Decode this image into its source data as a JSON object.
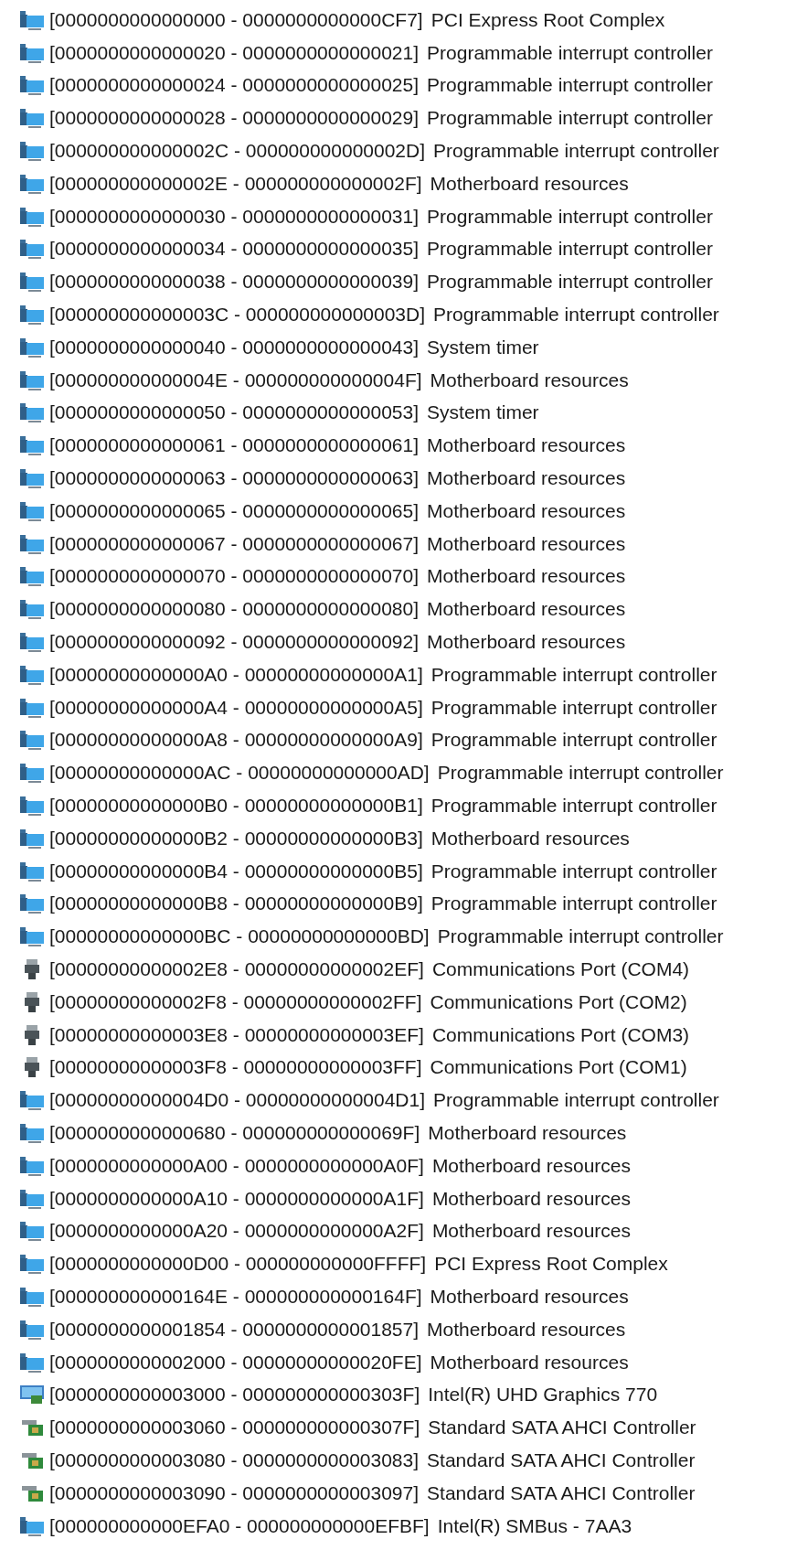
{
  "resources": [
    {
      "kind": "system",
      "range": "[0000000000000000 - 0000000000000CF7]",
      "name": "PCI Express Root Complex"
    },
    {
      "kind": "system",
      "range": "[0000000000000020 - 0000000000000021]",
      "name": "Programmable interrupt controller"
    },
    {
      "kind": "system",
      "range": "[0000000000000024 - 0000000000000025]",
      "name": "Programmable interrupt controller"
    },
    {
      "kind": "system",
      "range": "[0000000000000028 - 0000000000000029]",
      "name": "Programmable interrupt controller"
    },
    {
      "kind": "system",
      "range": "[000000000000002C - 000000000000002D]",
      "name": "Programmable interrupt controller"
    },
    {
      "kind": "system",
      "range": "[000000000000002E - 000000000000002F]",
      "name": "Motherboard resources"
    },
    {
      "kind": "system",
      "range": "[0000000000000030 - 0000000000000031]",
      "name": "Programmable interrupt controller"
    },
    {
      "kind": "system",
      "range": "[0000000000000034 - 0000000000000035]",
      "name": "Programmable interrupt controller"
    },
    {
      "kind": "system",
      "range": "[0000000000000038 - 0000000000000039]",
      "name": "Programmable interrupt controller"
    },
    {
      "kind": "system",
      "range": "[000000000000003C - 000000000000003D]",
      "name": "Programmable interrupt controller"
    },
    {
      "kind": "system",
      "range": "[0000000000000040 - 0000000000000043]",
      "name": "System timer"
    },
    {
      "kind": "system",
      "range": "[000000000000004E - 000000000000004F]",
      "name": "Motherboard resources"
    },
    {
      "kind": "system",
      "range": "[0000000000000050 - 0000000000000053]",
      "name": "System timer"
    },
    {
      "kind": "system",
      "range": "[0000000000000061 - 0000000000000061]",
      "name": "Motherboard resources"
    },
    {
      "kind": "system",
      "range": "[0000000000000063 - 0000000000000063]",
      "name": "Motherboard resources"
    },
    {
      "kind": "system",
      "range": "[0000000000000065 - 0000000000000065]",
      "name": "Motherboard resources"
    },
    {
      "kind": "system",
      "range": "[0000000000000067 - 0000000000000067]",
      "name": "Motherboard resources"
    },
    {
      "kind": "system",
      "range": "[0000000000000070 - 0000000000000070]",
      "name": "Motherboard resources"
    },
    {
      "kind": "system",
      "range": "[0000000000000080 - 0000000000000080]",
      "name": "Motherboard resources"
    },
    {
      "kind": "system",
      "range": "[0000000000000092 - 0000000000000092]",
      "name": "Motherboard resources"
    },
    {
      "kind": "system",
      "range": "[00000000000000A0 - 00000000000000A1]",
      "name": "Programmable interrupt controller"
    },
    {
      "kind": "system",
      "range": "[00000000000000A4 - 00000000000000A5]",
      "name": "Programmable interrupt controller"
    },
    {
      "kind": "system",
      "range": "[00000000000000A8 - 00000000000000A9]",
      "name": "Programmable interrupt controller"
    },
    {
      "kind": "system",
      "range": "[00000000000000AC - 00000000000000AD]",
      "name": "Programmable interrupt controller"
    },
    {
      "kind": "system",
      "range": "[00000000000000B0 - 00000000000000B1]",
      "name": "Programmable interrupt controller"
    },
    {
      "kind": "system",
      "range": "[00000000000000B2 - 00000000000000B3]",
      "name": "Motherboard resources"
    },
    {
      "kind": "system",
      "range": "[00000000000000B4 - 00000000000000B5]",
      "name": "Programmable interrupt controller"
    },
    {
      "kind": "system",
      "range": "[00000000000000B8 - 00000000000000B9]",
      "name": "Programmable interrupt controller"
    },
    {
      "kind": "system",
      "range": "[00000000000000BC - 00000000000000BD]",
      "name": "Programmable interrupt controller"
    },
    {
      "kind": "port",
      "range": "[00000000000002E8 - 00000000000002EF]",
      "name": "Communications Port (COM4)"
    },
    {
      "kind": "port",
      "range": "[00000000000002F8 - 00000000000002FF]",
      "name": "Communications Port (COM2)"
    },
    {
      "kind": "port",
      "range": "[00000000000003E8 - 00000000000003EF]",
      "name": "Communications Port (COM3)"
    },
    {
      "kind": "port",
      "range": "[00000000000003F8 - 00000000000003FF]",
      "name": "Communications Port (COM1)"
    },
    {
      "kind": "system",
      "range": "[00000000000004D0 - 00000000000004D1]",
      "name": "Programmable interrupt controller"
    },
    {
      "kind": "system",
      "range": "[0000000000000680 - 000000000000069F]",
      "name": "Motherboard resources"
    },
    {
      "kind": "system",
      "range": "[0000000000000A00 - 0000000000000A0F]",
      "name": "Motherboard resources"
    },
    {
      "kind": "system",
      "range": "[0000000000000A10 - 0000000000000A1F]",
      "name": "Motherboard resources"
    },
    {
      "kind": "system",
      "range": "[0000000000000A20 - 0000000000000A2F]",
      "name": "Motherboard resources"
    },
    {
      "kind": "system",
      "range": "[0000000000000D00 - 000000000000FFFF]",
      "name": "PCI Express Root Complex"
    },
    {
      "kind": "system",
      "range": "[000000000000164E - 000000000000164F]",
      "name": "Motherboard resources"
    },
    {
      "kind": "system",
      "range": "[0000000000001854 - 0000000000001857]",
      "name": "Motherboard resources"
    },
    {
      "kind": "system",
      "range": "[0000000000002000 - 00000000000020FE]",
      "name": "Motherboard resources"
    },
    {
      "kind": "display",
      "range": "[0000000000003000 - 000000000000303F]",
      "name": "Intel(R) UHD Graphics 770"
    },
    {
      "kind": "storage",
      "range": "[0000000000003060 - 000000000000307F]",
      "name": "Standard SATA AHCI Controller"
    },
    {
      "kind": "storage",
      "range": "[0000000000003080 - 0000000000003083]",
      "name": "Standard SATA AHCI Controller"
    },
    {
      "kind": "storage",
      "range": "[0000000000003090 - 0000000000003097]",
      "name": "Standard SATA AHCI Controller"
    },
    {
      "kind": "system",
      "range": "[000000000000EFA0 - 000000000000EFBF]",
      "name": "Intel(R) SMBus - 7AA3"
    }
  ]
}
